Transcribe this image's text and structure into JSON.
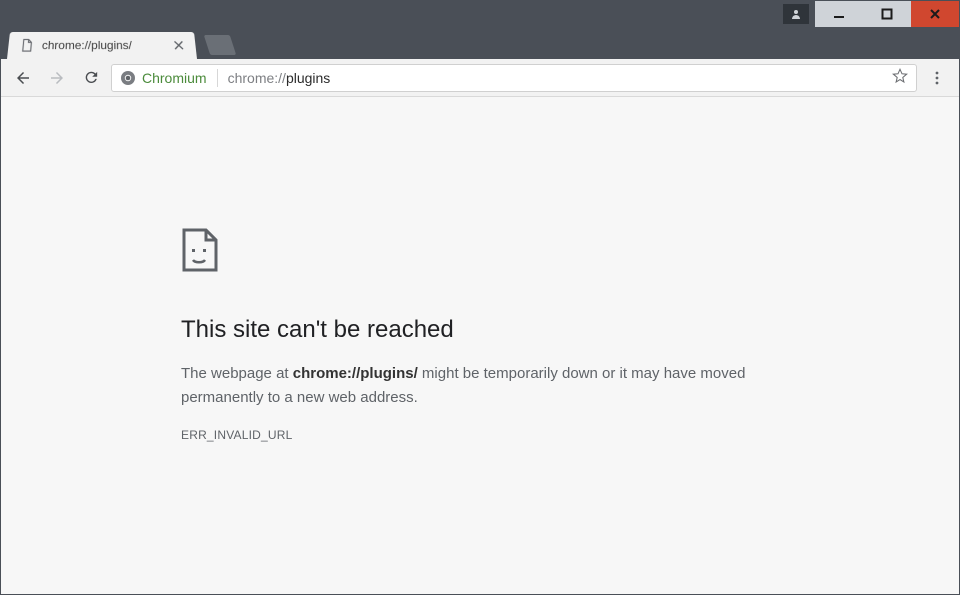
{
  "tab": {
    "title": "chrome://plugins/"
  },
  "omnibox": {
    "origin_label": "Chromium",
    "url_prefix": "chrome://",
    "url_path": "plugins"
  },
  "error": {
    "title": "This site can't be reached",
    "desc_pre": "The webpage at ",
    "desc_url": "chrome://plugins/",
    "desc_post": " might be temporarily down or it may have moved permanently to a new web address.",
    "code": "ERR_INVALID_URL"
  }
}
